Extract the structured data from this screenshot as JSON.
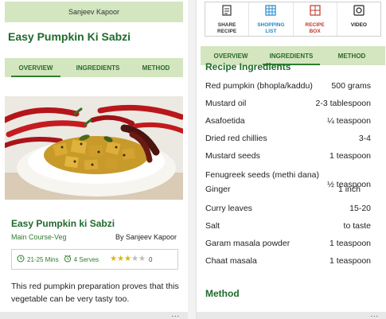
{
  "left": {
    "author": "Sanjeev Kapoor",
    "title": "Easy Pumpkin Ki Sabzi",
    "tabs": [
      "OVERVIEW",
      "INGREDIENTS",
      "METHOD"
    ],
    "active_tab": "OVERVIEW",
    "recipe_name": "Easy Pumpkin ki Sabzi",
    "category": "Main Course-Veg",
    "byline": "By Sanjeev Kapoor",
    "time": "21-25 Mins",
    "serves": "4 Serves",
    "rating": 3,
    "rating_max": 5,
    "rating_count": "0",
    "description": "This red pumpkin preparation proves that this vegetable can be very tasty too.",
    "more": "..."
  },
  "right": {
    "actions": [
      {
        "label": "SHARE\nRECIPE",
        "icon": "share-icon",
        "color": "#333333"
      },
      {
        "label": "SHOPPING\nLIST",
        "icon": "shopping-list-icon",
        "color": "#1e88c8"
      },
      {
        "label": "RECIPE\nBOX",
        "icon": "recipe-box-icon",
        "color": "#c0392b"
      },
      {
        "label": "VIDEO",
        "icon": "video-icon",
        "color": "#222222"
      }
    ],
    "tabs": [
      "OVERVIEW",
      "INGREDIENTS",
      "METHOD"
    ],
    "active_tab": "INGREDIENTS",
    "ingredients_title": "Recipe Ingredients",
    "ingredients": [
      {
        "name": "Red pumpkin (bhopla/kaddu)",
        "qty": "500 grams"
      },
      {
        "name": "Mustard oil",
        "qty": "2-3 tablespoon"
      },
      {
        "name": "Asafoetida",
        "qty": "¼ teaspoon"
      },
      {
        "name": "Dried red chillies",
        "qty": "3-4"
      },
      {
        "name": "Mustard seeds",
        "qty": "1 teaspoon"
      },
      {
        "name": "Fenugreek seeds (methi dana)",
        "qty": ""
      },
      {
        "name": "Ginger",
        "qty": "1 inch",
        "qty2": "½ teaspoon"
      },
      {
        "name": "Curry leaves",
        "qty": "15-20"
      },
      {
        "name": "Salt",
        "qty": "to taste"
      },
      {
        "name": "Garam masala powder",
        "qty": "1 teaspoon"
      },
      {
        "name": "Chaat masala",
        "qty": "1 teaspoon"
      }
    ],
    "method_title": "Method",
    "more": "..."
  },
  "colors": {
    "accent_green": "#1f6b2b",
    "tab_bar": "#d3e6bf",
    "star": "#e0b400"
  }
}
